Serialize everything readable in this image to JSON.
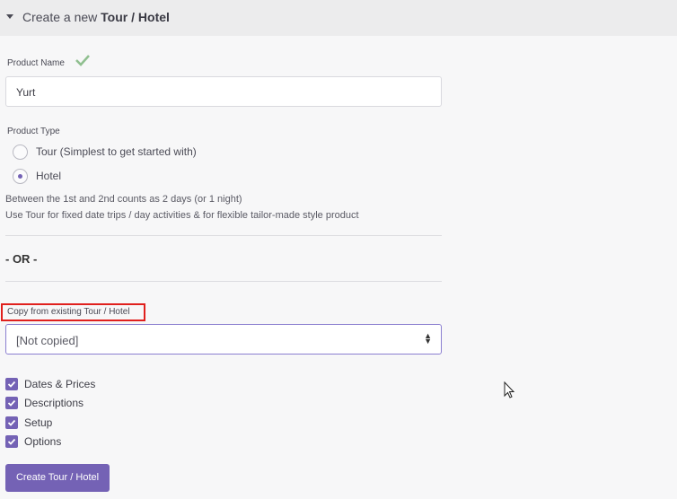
{
  "header": {
    "prefix": "Create a new",
    "title": "Tour / Hotel"
  },
  "product_name": {
    "label": "Product Name",
    "value": "Yurt",
    "status_icon": "check-icon"
  },
  "product_type": {
    "label": "Product Type",
    "options": [
      {
        "label": "Tour (Simplest to get started with)",
        "selected": false
      },
      {
        "label": "Hotel",
        "selected": true
      }
    ],
    "help": [
      "Between the 1st and 2nd counts as 2 days (or 1 night)",
      "Use Tour for fixed date trips / day activities & for flexible tailor-made style product"
    ]
  },
  "or_text": "- OR -",
  "copy": {
    "label": "Copy from existing Tour / Hotel",
    "selected_value": "[Not copied]"
  },
  "copy_options": [
    {
      "label": "Dates & Prices",
      "checked": true
    },
    {
      "label": "Descriptions",
      "checked": true
    },
    {
      "label": "Setup",
      "checked": true
    },
    {
      "label": "Options",
      "checked": true
    }
  ],
  "submit_label": "Create Tour / Hotel",
  "colors": {
    "accent": "#7462b5",
    "highlight_border": "#e0201d",
    "check": "#8fbf8f"
  }
}
